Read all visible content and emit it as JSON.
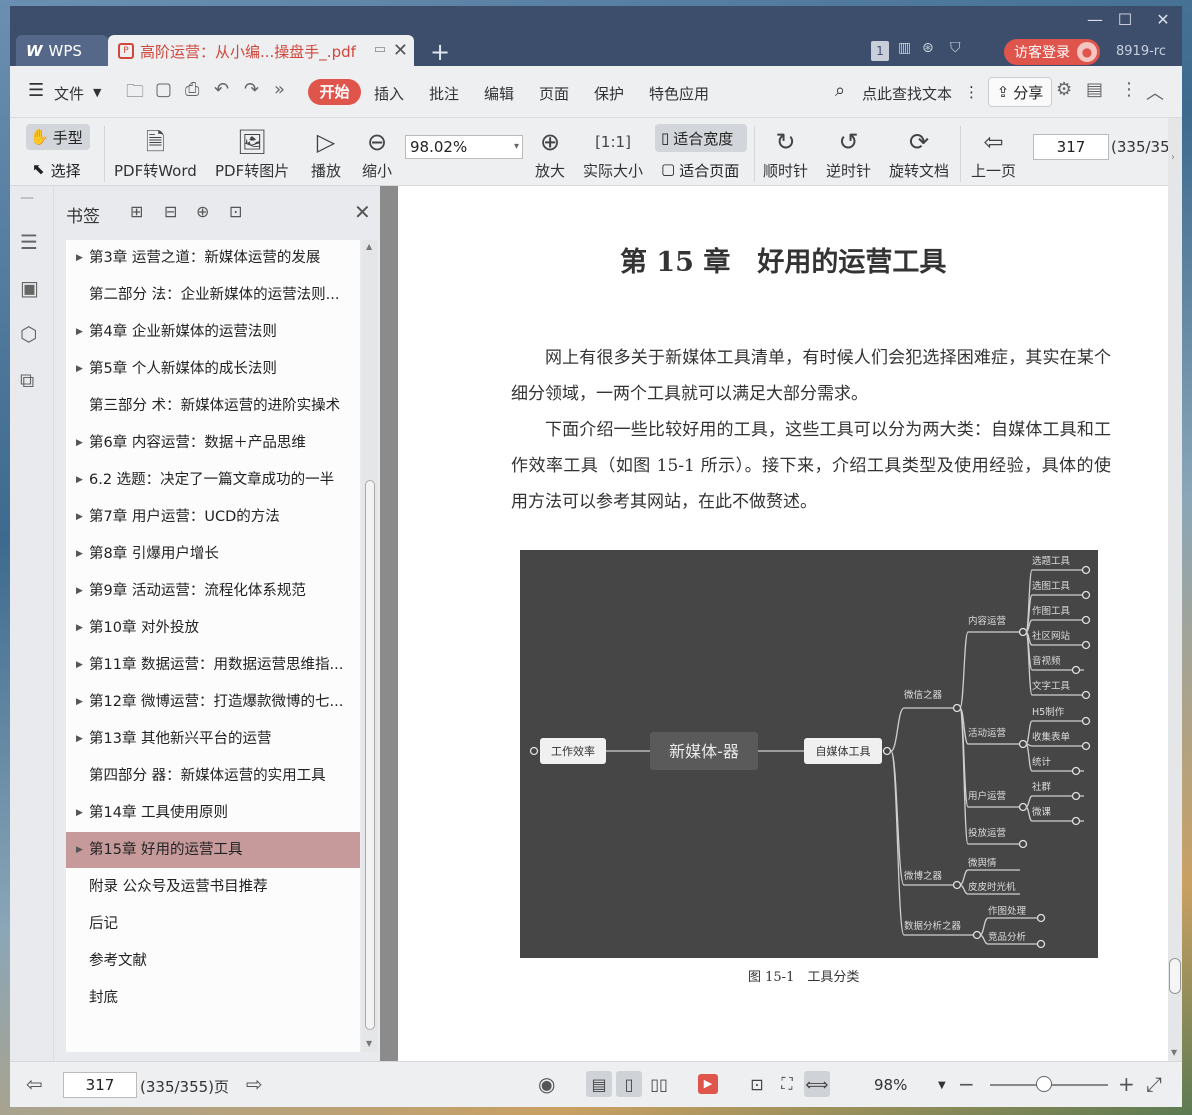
{
  "window": {
    "min_icon": "minimize-icon",
    "max_icon": "maximize-icon",
    "close_icon": "close-icon",
    "min": "—",
    "max": "☐",
    "close": "✕"
  },
  "tabs": {
    "wps_label": "WPS",
    "doc_label": "高阶运营：从小编...操盘手_.pdf",
    "add": "+"
  },
  "topright": {
    "badge": "1",
    "login": "访客登录",
    "version": "8919-rc"
  },
  "menu": {
    "file": "文件",
    "start": "开始",
    "items": [
      "插入",
      "批注",
      "编辑",
      "页面",
      "保护",
      "特色应用"
    ],
    "search": "点此查找文本",
    "share": "分享"
  },
  "toolbar": {
    "hand": "手型",
    "select": "选择",
    "pdf2word": "PDF转Word",
    "pdf2img": "PDF转图片",
    "play": "播放",
    "zoomout": "缩小",
    "zoom_value": "98.02%",
    "zoomin": "放大",
    "actual": "实际大小",
    "fit_width": "适合宽度",
    "fit_page": "适合页面",
    "cw": "顺时针",
    "ccw": "逆时针",
    "rotate": "旋转文档",
    "prev": "上一页",
    "page": "317",
    "page_total": "(335/35"
  },
  "sidebar": {
    "title": "书签",
    "items": [
      {
        "label": "第3章  运营之道：新媒体运营的发展",
        "expand": true
      },
      {
        "label": "第二部分  法：企业新媒体的运营法则...",
        "expand": false
      },
      {
        "label": "第4章  企业新媒体的运营法则",
        "expand": true
      },
      {
        "label": "第5章  个人新媒体的成长法则",
        "expand": true
      },
      {
        "label": "第三部分  术：新媒体运营的进阶实操术",
        "expand": false
      },
      {
        "label": "第6章  内容运营：数据＋产品思维",
        "expand": true
      },
      {
        "label": "6.2  选题：决定了一篇文章成功的一半",
        "expand": true
      },
      {
        "label": "第7章  用户运营：UCD的方法",
        "expand": true
      },
      {
        "label": "第8章  引爆用户增长",
        "expand": true
      },
      {
        "label": "第9章  活动运营：流程化体系规范",
        "expand": true
      },
      {
        "label": "第10章  对外投放",
        "expand": true
      },
      {
        "label": "第11章  数据运营：用数据运营思维指...",
        "expand": true
      },
      {
        "label": "第12章  微博运营：打造爆款微博的七...",
        "expand": true
      },
      {
        "label": "第13章  其他新兴平台的运营",
        "expand": true
      },
      {
        "label": "第四部分  器：新媒体运营的实用工具",
        "expand": false
      },
      {
        "label": "第14章  工具使用原则",
        "expand": true
      },
      {
        "label": "第15章  好用的运营工具",
        "expand": true,
        "selected": true
      },
      {
        "label": "附录  公众号及运营书目推荐",
        "expand": false
      },
      {
        "label": "后记",
        "expand": false
      },
      {
        "label": "参考文献",
        "expand": false
      },
      {
        "label": "封底",
        "expand": false
      }
    ]
  },
  "document": {
    "chapter_title": "第 15 章　好用的运营工具",
    "para1": "网上有很多关于新媒体工具清单，有时候人们会犯选择困难症，其实在某个细分领域，一两个工具就可以满足大部分需求。",
    "para2": "下面介绍一些比较好用的工具，这些工具可以分为两大类：自媒体工具和工作效率工具（如图 15-1 所示）。接下来，介绍工具类型及使用经验，具体的使用方法可以参考其网站，在此不做赘述。",
    "figure_caption": "图 15-1　工具分类",
    "mindmap": {
      "center": "新媒体-器",
      "left": "工作效率",
      "right": "自媒体工具",
      "groups": [
        {
          "name": "微信之器",
          "subs": [
            {
              "name": "内容运营",
              "leaves": [
                "选题工具",
                "选图工具",
                "作图工具",
                "社区网站",
                "音视频",
                "文字工具"
              ]
            },
            {
              "name": "活动运营",
              "leaves": [
                "H5制作",
                "收集表单",
                "统计"
              ]
            },
            {
              "name": "用户运营",
              "leaves": [
                "社群",
                "微课"
              ]
            },
            {
              "name": "投放运营",
              "leaves": []
            }
          ]
        },
        {
          "name": "微博之器",
          "leaves": [
            "微舆情",
            "皮皮时光机"
          ]
        },
        {
          "name": "数据分析之器",
          "leaves": [
            "作图处理",
            "竞品分析"
          ]
        }
      ]
    }
  },
  "status": {
    "page": "317",
    "page_info": "(335/355)页",
    "zoom": "98%"
  }
}
